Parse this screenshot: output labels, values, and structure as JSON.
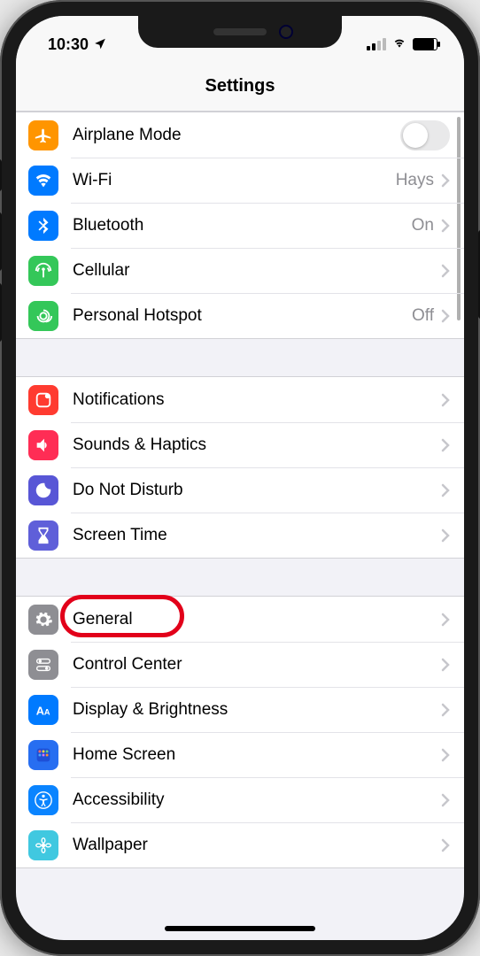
{
  "status": {
    "time": "10:30"
  },
  "header": {
    "title": "Settings"
  },
  "groups": [
    {
      "rows": [
        {
          "id": "airplane",
          "label": "Airplane Mode",
          "iconColor": "bg-orange",
          "icon": "airplane-icon",
          "control": "toggle",
          "toggled": false
        },
        {
          "id": "wifi",
          "label": "Wi-Fi",
          "value": "Hays",
          "iconColor": "bg-blue",
          "icon": "wifi-icon",
          "control": "disclosure"
        },
        {
          "id": "bluetooth",
          "label": "Bluetooth",
          "value": "On",
          "iconColor": "bg-blue",
          "icon": "bluetooth-icon",
          "control": "disclosure"
        },
        {
          "id": "cellular",
          "label": "Cellular",
          "iconColor": "bg-green",
          "icon": "antenna-icon",
          "control": "disclosure"
        },
        {
          "id": "hotspot",
          "label": "Personal Hotspot",
          "value": "Off",
          "iconColor": "bg-green",
          "icon": "hotspot-icon",
          "control": "disclosure"
        }
      ]
    },
    {
      "rows": [
        {
          "id": "notifications",
          "label": "Notifications",
          "iconColor": "bg-red",
          "icon": "notifications-icon",
          "control": "disclosure"
        },
        {
          "id": "sounds",
          "label": "Sounds & Haptics",
          "iconColor": "bg-pink",
          "icon": "sounds-icon",
          "control": "disclosure"
        },
        {
          "id": "dnd",
          "label": "Do Not Disturb",
          "iconColor": "bg-purple",
          "icon": "moon-icon",
          "control": "disclosure"
        },
        {
          "id": "screentime",
          "label": "Screen Time",
          "iconColor": "bg-indigo",
          "icon": "hourglass-icon",
          "control": "disclosure"
        }
      ]
    },
    {
      "rows": [
        {
          "id": "general",
          "label": "General",
          "iconColor": "bg-gray",
          "icon": "gear-icon",
          "control": "disclosure",
          "highlighted": true
        },
        {
          "id": "controlcenter",
          "label": "Control Center",
          "iconColor": "bg-gray",
          "icon": "switches-icon",
          "control": "disclosure"
        },
        {
          "id": "display",
          "label": "Display & Brightness",
          "iconColor": "bg-blue",
          "icon": "text-size-icon",
          "control": "disclosure"
        },
        {
          "id": "homescreen",
          "label": "Home Screen",
          "iconColor": "bg-hblue",
          "icon": "grid-icon",
          "control": "disclosure"
        },
        {
          "id": "accessibility",
          "label": "Accessibility",
          "iconColor": "bg-blue2",
          "icon": "accessibility-icon",
          "control": "disclosure"
        },
        {
          "id": "wallpaper",
          "label": "Wallpaper",
          "iconColor": "bg-teal",
          "icon": "flower-icon",
          "control": "disclosure"
        }
      ]
    }
  ]
}
